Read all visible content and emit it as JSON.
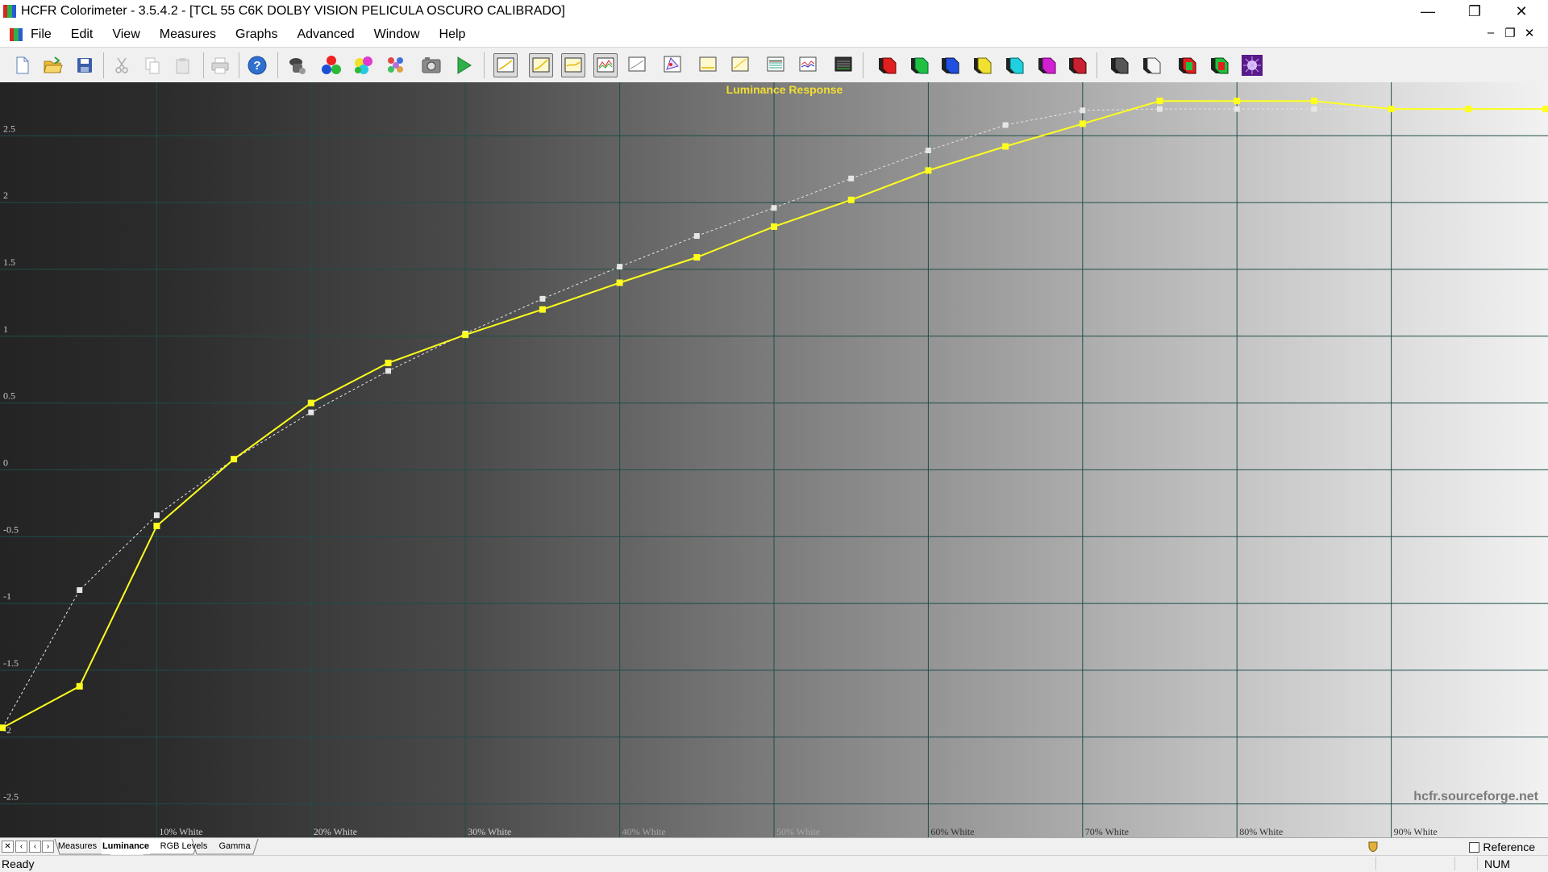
{
  "app": {
    "title": "HCFR Colorimeter - 3.5.4.2 - [TCL 55 C6K DOLBY VISION PELICULA OSCURO CALIBRADO]"
  },
  "menu": [
    "File",
    "Edit",
    "View",
    "Measures",
    "Graphs",
    "Advanced",
    "Window",
    "Help"
  ],
  "toolbar_icons": [
    "new-document-icon",
    "open-folder-icon",
    "save-icon",
    "cut-icon",
    "copy-icon",
    "paste-icon",
    "print-icon",
    "help-icon",
    "sensor-icon",
    "rgb-primaries-icon",
    "secondaries-icon",
    "color-checker-icon",
    "camera-icon",
    "play-icon",
    "graph-1-icon",
    "graph-2-icon",
    "graph-3-icon",
    "graph-4-icon",
    "graph-5-icon",
    "cie-diagram-icon",
    "graph-6-icon",
    "graph-7-icon",
    "graph-8-icon",
    "graph-9-icon",
    "graph-10-icon",
    "measure-red-icon",
    "measure-green-icon",
    "measure-blue-icon",
    "measure-yellow-icon",
    "measure-cyan-icon",
    "measure-magenta-icon",
    "measure-red-2-icon",
    "measure-gray-icon",
    "measure-white-icon",
    "measure-multi-1-icon",
    "measure-multi-2-icon",
    "pattern-generator-icon"
  ],
  "tabs": [
    "Measures",
    "Luminance",
    "RGB Levels",
    "Gamma"
  ],
  "active_tab": "Luminance",
  "reference_label": "Reference",
  "status": {
    "ready": "Ready",
    "num": "NUM"
  },
  "chart_data": {
    "type": "line",
    "title": "Luminance Response",
    "watermark": "hcfr.sourceforge.net",
    "xlabel": "",
    "ylabel": "",
    "ylim": [
      -2.75,
      2.9
    ],
    "yticks": [
      2.5,
      2,
      1.5,
      1,
      0.5,
      0,
      -0.5,
      -1,
      -1.5,
      -2,
      -2.5
    ],
    "ytick_labels": [
      "2.5",
      "2",
      "1.5",
      "1",
      "0.5",
      "0",
      "-0.5",
      "-1",
      "-1.5",
      "-2",
      "-2.5"
    ],
    "xlim": [
      0,
      100
    ],
    "xticks": [
      10,
      20,
      30,
      40,
      50,
      60,
      70,
      80,
      90
    ],
    "xtick_labels": [
      "10% White",
      "20% White",
      "30% White",
      "40% White",
      "50% White",
      "60% White",
      "70% White",
      "80% White",
      "90% White"
    ],
    "grid": true,
    "series": [
      {
        "color": "#ffff1e",
        "style": "solid",
        "x": [
          0,
          5,
          10,
          15,
          20,
          25,
          30,
          35,
          40,
          45,
          50,
          55,
          60,
          65,
          70,
          75,
          80,
          85,
          90,
          95,
          100
        ],
        "values": [
          -1.93,
          -1.62,
          -0.42,
          0.08,
          0.5,
          0.8,
          1.01,
          1.2,
          1.4,
          1.59,
          1.82,
          2.02,
          2.24,
          2.42,
          2.59,
          2.76,
          2.76,
          2.76,
          2.7,
          2.7,
          2.7
        ]
      },
      {
        "color": "#e6e6e6",
        "style": "dashed",
        "x": [
          0,
          5,
          10,
          15,
          20,
          25,
          30,
          35,
          40,
          45,
          50,
          55,
          60,
          65,
          70,
          75,
          80,
          85,
          90,
          95,
          100
        ],
        "values": [
          -1.93,
          -0.9,
          -0.34,
          0.08,
          0.43,
          0.74,
          1.02,
          1.28,
          1.52,
          1.75,
          1.96,
          2.18,
          2.39,
          2.58,
          2.69,
          2.7,
          2.7,
          2.7,
          2.7,
          2.7,
          2.7
        ]
      }
    ]
  }
}
